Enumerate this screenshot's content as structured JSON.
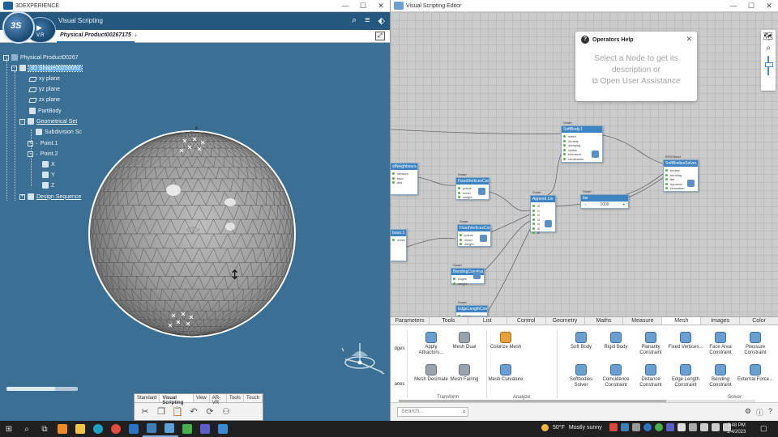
{
  "left_window": {
    "title": "3DEXPERIENCE",
    "app_name": "Visual Scripting",
    "compass_ds": "3S",
    "version": "V.R",
    "tab_label": "Physical Product00267175",
    "tab_plus": "+",
    "tree": {
      "root": "Physical Product00267",
      "shape": "3D Shape00250062",
      "xy": "xy plane",
      "yz": "yz plane",
      "zx": "zx plane",
      "partbody": "PartBody",
      "geoset": "Geometrical Set",
      "subdiv": "Subdivision Sc",
      "point1": "Point.1",
      "point2": "Point.2",
      "x": "X",
      "y": "Y",
      "z": "Z",
      "design": "Design Sequence"
    },
    "action_bar": {
      "tabs": [
        "Standard",
        "Visual Scripting",
        "View",
        "AR-VR",
        "Tools",
        "Touch"
      ],
      "active": "Visual Scripting"
    }
  },
  "right_window": {
    "title": "Visual Scripting Editor",
    "ops_help": {
      "title": "Operators Help",
      "line1": "Select a Node to get its",
      "line2": "description or",
      "link": "Open User Assistance"
    },
    "nodes": {
      "softbody": {
        "pre": "Smart",
        "title": "SoftBody.1",
        "ports": [
          "mesh",
          "density",
          "damping",
          "radius",
          "tolerance",
          "constraints"
        ]
      },
      "solver": {
        "pre": "RSSSmart",
        "title": "SoftBodiesSolver.1",
        "ports": [
          "bodies",
          "bending",
          "iter",
          "dynamic",
          "relaxation"
        ]
      },
      "fixed": {
        "pre": "Smart",
        "title": "FixedVerticesCon",
        "ports": [
          "points",
          "mesh",
          "weight"
        ]
      },
      "append": {
        "pre": "Smart",
        "title": "Append Lis",
        "ports": [
          "i0",
          "i1",
          "i2",
          "i3",
          "i4",
          "i5",
          "i6"
        ]
      },
      "iter": {
        "pre": "Smart",
        "title": "iter",
        "value": "1000"
      },
      "neighbours": {
        "pre": "",
        "title": "stNeighbours.1",
        "ports": [
          "vertices",
          "face",
          "dist"
        ]
      },
      "fixed2": {
        "pre": "Smart",
        "title": "FixedVerticesCon",
        "ports": [
          "points",
          "mesh",
          "weight"
        ]
      },
      "bound": {
        "pre": "",
        "title": "boun.1",
        "ports": [
          "mesh"
        ]
      },
      "bending": {
        "pre": "Smart",
        "title": "BendingConstrai",
        "ports": [
          "edges",
          "weight"
        ]
      },
      "edgelen": {
        "pre": "Smart",
        "title": "EdgeLengthConst",
        "ports": [
          "edges"
        ]
      }
    },
    "library_tabs": [
      "Parameters",
      "Tools",
      "List",
      "Control",
      "Geometry",
      "Maths",
      "Measure",
      "Mesh",
      "Images",
      "Color"
    ],
    "active_library_tab": "Mesh",
    "library_items": {
      "edges": "dges",
      "faces": "aces",
      "attractors": "Apply Attractors...",
      "mesh_dual": "Mesh Dual",
      "decimate": "Mesh Decimate",
      "fairing": "Mesh Fairing",
      "colorize": "Colorize Mesh",
      "curvature": "Mesh Curvature",
      "soft_body": "Soft Body",
      "rigid_body": "Rigid Body",
      "planarity": "Planarity Constraint",
      "fixed_vertices": "Fixed Vertices...",
      "face_area": "Face Area Constraint",
      "pressure": "Pressure Constraint",
      "softbodies_solver": "Softbodies Solver",
      "coincidence": "Coincidence Constraint",
      "distance": "Distance Constraint",
      "edge_length": "Edge Length Constraint",
      "bending": "Bending Constraint",
      "external_force": "External Force..."
    },
    "library_groups": {
      "transform": "Transform",
      "analyze": "Analyze",
      "solver": "Solver"
    },
    "search_placeholder": "Search..."
  },
  "taskbar": {
    "weather_temp": "50°F",
    "weather_desc": "Mostly sunny",
    "time": "3:48 PM",
    "date": "1/4/2023"
  },
  "colors": {
    "viewport_bg": "#3b6f94",
    "header_blue": "#25587f",
    "node_header": "#3f84c2",
    "selection": "#5ca7e6"
  }
}
